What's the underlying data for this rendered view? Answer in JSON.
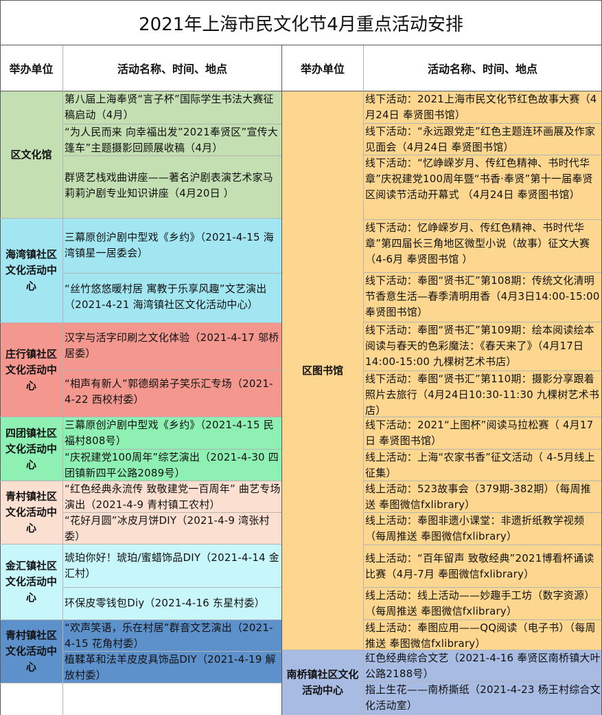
{
  "title": "2021年上海市民文化节4月重点活动安排",
  "headers": {
    "unit_left": "举办单位",
    "activity_left": "活动名称、时间、地点",
    "unit_right": "举办单位",
    "activity_right": "活动名称、时间、地点"
  },
  "left_groups": [
    {
      "unit": "区文化馆",
      "rows": [
        "第八届上海奉贤“言子杯”国际学生书法大赛征稿启动（4月）",
        "“为人民而来 向幸福出发”2021奉贤区”宣传大篷车”主题摄影回顾展收稿（4月）",
        "群贤艺栈戏曲讲座——著名沪剧表演艺术家马莉莉沪剧专业知识讲座（4月20日 ）"
      ]
    },
    {
      "unit": "海湾镇社区文化活动中心",
      "rows": [
        "三幕原创沪剧中型戏《乡约》（2021-4-15 海湾镇星一居委会）",
        "“丝竹悠悠暖村居 寓教于乐享风趣”文艺演出（2021-4-21 海湾镇社区文化活动中心）"
      ]
    },
    {
      "unit": "庄行镇社区文化活动中心",
      "rows": [
        "汉字与活字印刷之文化体验（2021-4-17 邬桥居委）",
        "“相声有新人”郭德纲弟子笑乐汇专场（2021-4-22 西校村委）"
      ]
    },
    {
      "unit": "四团镇社区文化活动中心",
      "rows": [
        "三幕原创沪剧中型戏《乡约》（2021-4-15 民福村808号）",
        "“庆祝建党100周年”综艺演出（2021-4-30 四团镇新四平公路2089号）"
      ]
    },
    {
      "unit": "青村镇社区文化活动中心",
      "rows": [
        "“红色经典永流传  致敬建党一百周年” 曲艺专场演出（2021-4-9 青村镇工农村）",
        "“花好月圆”冰皮月饼DIY（2021-4-9 湾张村委）"
      ]
    },
    {
      "unit": "金汇镇社区文化活动中心",
      "rows": [
        "琥珀你好！琥珀/蜜蜡饰品DIY（2021-4-14 金汇村）",
        "环保皮零钱包Diy（2021-4-16 东星村委）"
      ]
    },
    {
      "unit": "青村镇社区文化活动中心",
      "rows": [
        "“欢声笑语，乐在村居”群音文艺演出（2021-4-15 花角村委）",
        "植鞣革和法羊皮皮具饰品DIY（2021-4-19 解放村委）"
      ]
    }
  ],
  "right_groups": [
    {
      "unit": "区图书馆",
      "rows": [
        "线下活动：2021上海市民文化节红色故事大赛（4月24日 奉贤图书馆）",
        "线下活动：“永远跟党走”红色主题连环画展及作家见面会（4月24日 奉贤图书馆）",
        "线下活动：“忆峥嵘岁月、传红色精神、书时代华章”庆祝建党100周年暨“书香·奉贤”第十一届奉贤区阅读节活动开幕式 （4月24日 奉贤图书馆）",
        "线下活动：忆峥嵘岁月、传红色精神、书时代华章”第四届长三角地区微型小说（故事）征文大赛 （4-6月  奉贤图书馆 ）",
        "线下活动：奉图“贤书汇”第108期：传统文化清明节香意生活—春季清明用香（4月3日14:00-15:00 奉贤图书馆）",
        "线下活动：奉图“贤书汇”第109期：绘本阅读绘本阅读与春天的色彩魔法：《春天来了》（4月17日 14:00-15:00 九棵树艺术书店）",
        "线下活动：奉图“贤书汇”第110期：摄影分享跟着照片去旅行（4月24日10:30-11:30 九棵树艺术书店）",
        "线下活动：2021“上图杯”阅读马拉松赛（ 4月17日  奉贤图书馆）",
        "线上活动：上海“农家书香”征文活动（ 4-5月线上征集）",
        "线上活动：523故事会（379期-382期）（每周推送 奉图微信fxlibrary）",
        "线上活动：奉图非遗小课堂：非遗折纸教学视频（每周推送 奉图微信fxlibrary）",
        "线上活动：“百年留声 致敬经典”2021博看杯诵读比赛（4月-7月 奉图微信fxlibrary）",
        "线上活动：线上活动——妙趣手工坊（数字资源）（每周推送 奉图微信fxlibrary）",
        "线上活动：奉图应用——QQ阅读（电子书）（每周推送 奉图微信fxlibrary）"
      ]
    },
    {
      "unit": "南桥镇社区文化活动中心",
      "rows": [
        "红色经典综合文艺（2021-4-16 奉贤区南桥镇大叶公路2188号）",
        "指上生花——南桥撕纸（2021-4-23 杨王村综合文化活动室）"
      ]
    }
  ],
  "colors": {
    "green": "#c4dfb2",
    "cyan": "#a2e6f2",
    "red": "#f4988f",
    "mint": "#8ff0b3",
    "peach": "#fbe0d2",
    "light_cyan": "#c8f7fb",
    "blue": "#5d91cc",
    "gold": "#fdd78f",
    "lavender": "#a8bbe2"
  }
}
